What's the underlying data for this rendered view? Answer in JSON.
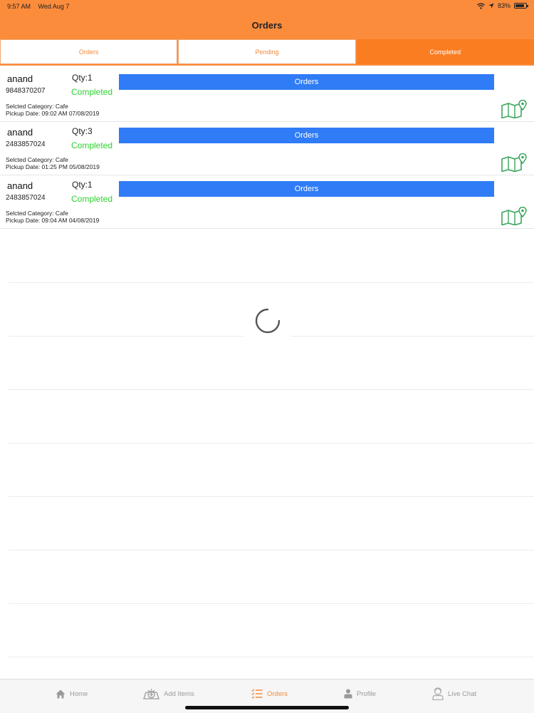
{
  "status_bar": {
    "time": "9:57 AM",
    "date": "Wed Aug 7",
    "battery": "83%",
    "battery_level": 0.83
  },
  "header": {
    "title": "Orders"
  },
  "tabs": [
    {
      "label": "Orders",
      "active": false
    },
    {
      "label": "Pending",
      "active": false
    },
    {
      "label": "Completed",
      "active": true
    }
  ],
  "orders": [
    {
      "name": "anand",
      "phone": "9848370207",
      "qty": "Qty:1",
      "status": "Completed",
      "button": "Orders",
      "category": "Selcted Category: Cafe",
      "pickup": "Pickup Date: 09:02 AM 07/08/2019"
    },
    {
      "name": "anand",
      "phone": "2483857024",
      "qty": "Qty:3",
      "status": "Completed",
      "button": "Orders",
      "category": "Selcted Category: Cafe",
      "pickup": "Pickup Date: 01:25 PM 05/08/2019"
    },
    {
      "name": "anand",
      "phone": "2483857024",
      "qty": "Qty:1",
      "status": "Completed",
      "button": "Orders",
      "category": "Selcted Category: Cafe",
      "pickup": "Pickup Date: 09:04 AM 04/08/2019"
    }
  ],
  "tabbar": [
    {
      "label": "Home",
      "icon": "home-icon",
      "active": false
    },
    {
      "label": "Add Items",
      "icon": "add-items-icon",
      "active": false
    },
    {
      "label": "Orders",
      "icon": "orders-list-icon",
      "active": true
    },
    {
      "label": "Profile",
      "icon": "profile-icon",
      "active": false
    },
    {
      "label": "Live Chat",
      "icon": "live-chat-icon",
      "active": false
    }
  ],
  "colors": {
    "accent": "#fb8c3c",
    "active_tab": "#fb7d22",
    "button_blue": "#2f7cf6",
    "status_green": "#2ed12e"
  }
}
